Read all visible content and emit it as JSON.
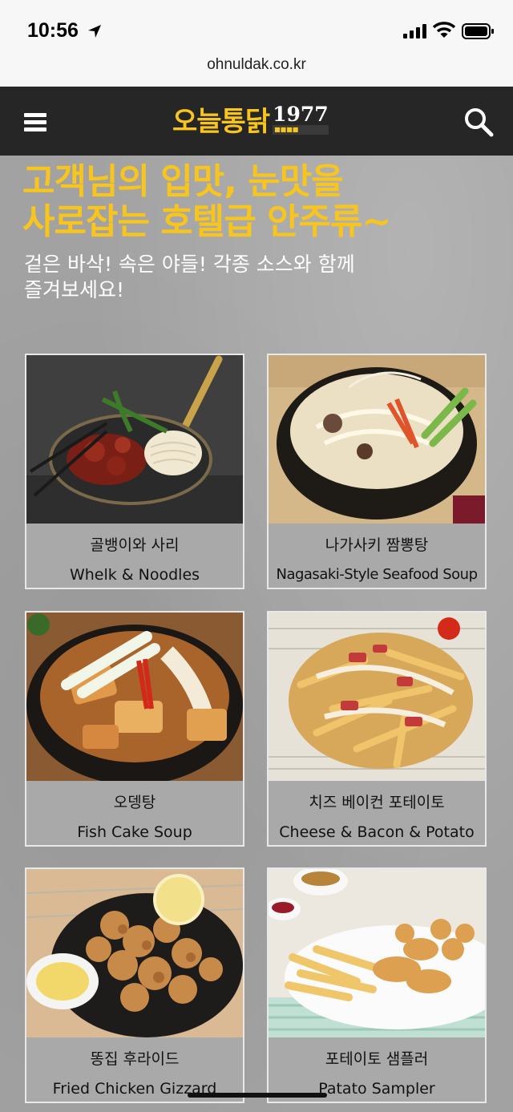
{
  "status_bar": {
    "time": "10:56"
  },
  "browser": {
    "url": "ohnuldak.co.kr"
  },
  "header": {
    "logo_korean": "오늘통닭",
    "logo_year": "1977"
  },
  "hero": {
    "headline_line1": "고객님의 입맛, 눈맛을",
    "headline_line2": "사로잡는 호텔급 안주류~",
    "subline_line1": "겉은 바삭! 속은 야들! 각종 소스와 함께",
    "subline_line2": "즐겨보세요!"
  },
  "menu_items": [
    {
      "name_kr": "골뱅이와 사리",
      "name_en": "Whelk & Noodles"
    },
    {
      "name_kr": "나가사키 짬뽕탕",
      "name_en": "Nagasaki-Style Seafood Soup"
    },
    {
      "name_kr": "오뎅탕",
      "name_en": "Fish Cake Soup"
    },
    {
      "name_kr": "치즈 베이컨 포테이토",
      "name_en": "Cheese & Bacon & Potato"
    },
    {
      "name_kr": "똥집 후라이드",
      "name_en": "Fried Chicken Gizzard"
    },
    {
      "name_kr": "포테이토 샘플러",
      "name_en": "Patato Sampler"
    }
  ],
  "colors": {
    "brand_yellow": "#f7c51e",
    "header_bg": "#262626",
    "page_bg": "#a2a2a2"
  },
  "icons": [
    "location-arrow-icon",
    "signal-icon",
    "wifi-icon",
    "battery-icon",
    "hamburger-menu-icon",
    "search-icon"
  ]
}
